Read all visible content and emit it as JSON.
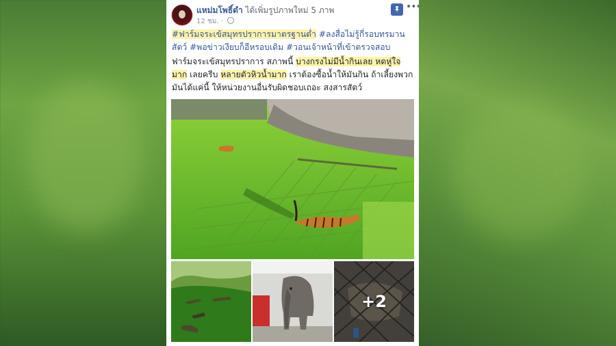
{
  "post": {
    "author": "แหม่มโพธิ์ดำ",
    "action": "ได้เพิ่มรูปภาพใหม่ 5 ภาพ",
    "time": "12 ชม.",
    "hashtags": {
      "tag1": "#ฟาร์มจระเข้สมุทรปราการมาตรฐานต่ำ",
      "tag2": "#ลงสื่อไม่รู้กี่รอบทรมานสัตว์",
      "tag3": "#พอข่าวเงียบก็อีหรอบเดิม",
      "tag4": "#วอนเจ้าหน้าที่เข้าตรวจสอบ"
    },
    "body": {
      "part1": "ฟาร์มจระเข้สมุทรปราการ สภาพนี้ ",
      "hl1": "บางกรงไม่มีน้ำกินเลย หดหู่ใจมาก",
      "part2": "เลยครีบ ",
      "hl2": "หลายตัวหิวน้ำมาก",
      "part3": " เราต้องซื้อน้ำให้มันกิน ถ้าเลี้ยงพวกมันได้แค่นี้ ให้หน่วยงานอื่นรับผิดชอบเถอะ สงสารสัตว์"
    },
    "more_photos": "+2"
  },
  "icons": {
    "pin": "pin-icon",
    "more": "more-options-icon",
    "privacy": "globe-icon"
  },
  "colors": {
    "link": "#365899",
    "highlight": "#fff3a8",
    "pin_bg": "#4267b2"
  }
}
